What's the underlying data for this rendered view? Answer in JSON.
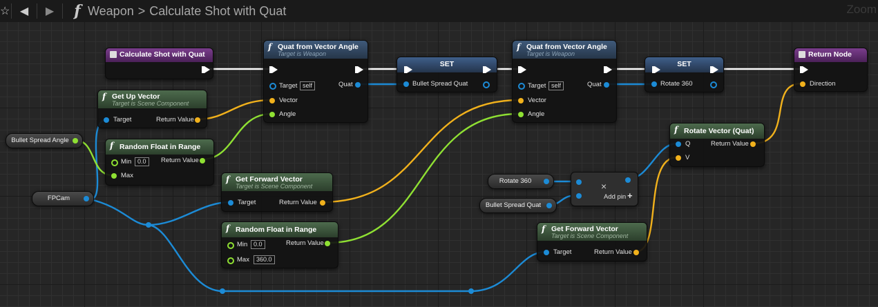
{
  "breadcrumb": {
    "part1": "Weapon",
    "separator": ">",
    "part2": "Calculate Shot with Quat"
  },
  "zoom_label": "Zoom",
  "colors": {
    "exec": "#ffffff",
    "object": "#1c8bd6",
    "vector": "#f1b11c",
    "float": "#8fe033"
  },
  "nodes": {
    "entry": {
      "title": "Calculate Shot with Quat"
    },
    "get_up_vector": {
      "title": "Get Up Vector",
      "subtitle": "Target is Scene Component",
      "in_target": "Target",
      "out": "Return Value"
    },
    "random_float_1": {
      "title": "Random Float in Range",
      "in_min": "Min",
      "min_value": "0.0",
      "in_max": "Max",
      "out": "Return Value"
    },
    "quat_angle_1": {
      "title": "Quat from Vector Angle",
      "subtitle": "Target is Weapon",
      "in_target": "Target",
      "target_value": "self",
      "in_vector": "Vector",
      "in_angle": "Angle",
      "out": "Quat"
    },
    "set_1": {
      "title": "SET",
      "pin": "Bullet Spread Quat"
    },
    "get_forward_1": {
      "title": "Get Forward Vector",
      "subtitle": "Target is Scene Component",
      "in_target": "Target",
      "out": "Return Value"
    },
    "random_float_2": {
      "title": "Random Float in Range",
      "in_min": "Min",
      "min_value": "0.0",
      "in_max": "Max",
      "max_value": "360.0",
      "out": "Return Value"
    },
    "quat_angle_2": {
      "title": "Quat from Vector Angle",
      "subtitle": "Target is Weapon",
      "in_target": "Target",
      "target_value": "self",
      "in_vector": "Vector",
      "in_angle": "Angle",
      "out": "Quat"
    },
    "set_2": {
      "title": "SET",
      "pin": "Rotate 360"
    },
    "rotate_vector": {
      "title": "Rotate Vector (Quat)",
      "in_q": "Q",
      "in_v": "V",
      "out": "Return Value"
    },
    "multiply": {
      "symbol": "×",
      "add_pin": "Add pin",
      "add_symbol": "+"
    },
    "get_forward_2": {
      "title": "Get Forward Vector",
      "subtitle": "Target is Scene Component",
      "in_target": "Target",
      "out": "Return Value"
    },
    "return_node": {
      "title": "Return Node",
      "in_direction": "Direction"
    }
  },
  "variables": {
    "bullet_spread_angle": "Bullet Spread Angle",
    "fpcam": "FPCam",
    "rotate_360": "Rotate 360",
    "bullet_spread_quat": "Bullet Spread Quat"
  }
}
